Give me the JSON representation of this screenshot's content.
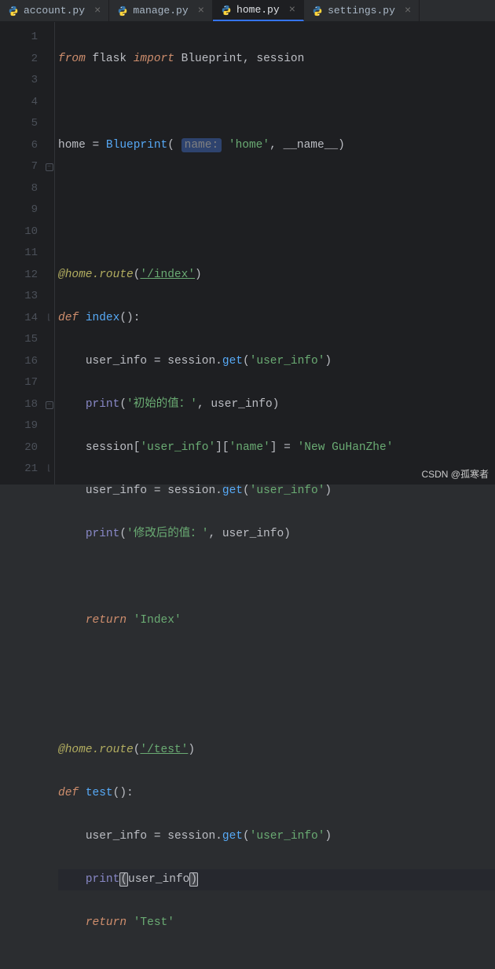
{
  "tabs": [
    {
      "label": "account.py",
      "active": false
    },
    {
      "label": "manage.py",
      "active": false
    },
    {
      "label": "home.py",
      "active": true
    },
    {
      "label": "settings.py",
      "active": false
    }
  ],
  "lines": [
    {
      "n": 1,
      "fold": ""
    },
    {
      "n": 2,
      "fold": ""
    },
    {
      "n": 3,
      "fold": ""
    },
    {
      "n": 4,
      "fold": ""
    },
    {
      "n": 5,
      "fold": ""
    },
    {
      "n": 6,
      "fold": ""
    },
    {
      "n": 7,
      "fold": "⊟"
    },
    {
      "n": 8,
      "fold": ""
    },
    {
      "n": 9,
      "fold": ""
    },
    {
      "n": 10,
      "fold": ""
    },
    {
      "n": 11,
      "fold": ""
    },
    {
      "n": 12,
      "fold": ""
    },
    {
      "n": 13,
      "fold": ""
    },
    {
      "n": 14,
      "fold": "⌊"
    },
    {
      "n": 15,
      "fold": ""
    },
    {
      "n": 16,
      "fold": ""
    },
    {
      "n": 17,
      "fold": ""
    },
    {
      "n": 18,
      "fold": "⊟"
    },
    {
      "n": 19,
      "fold": ""
    },
    {
      "n": 20,
      "fold": ""
    },
    {
      "n": 21,
      "fold": "⌊"
    }
  ],
  "code": {
    "l1_from": "from",
    "l1_flask": "flask",
    "l1_import": "import",
    "l1_bp": "Blueprint",
    "l1_sess": "session",
    "l3_home": "home",
    "l3_bp": "Blueprint",
    "l3_name": "name:",
    "l3_str": "'home'",
    "l3_nm": "__name__",
    "l6_dec": "@home.route",
    "l6_str": "'/index'",
    "l7_def": "def",
    "l7_fn": "index",
    "l8_ui": "user_info",
    "l8_sess": "session",
    "l8_get": "get",
    "l8_str": "'user_info'",
    "l9_print": "print",
    "l9_str": "'初始的值：'",
    "l9_ui": "user_info",
    "l10_sess": "session",
    "l10_s1": "'user_info'",
    "l10_s2": "'name'",
    "l10_s3": "'New GuHanZhe'",
    "l11_ui": "user_info",
    "l11_sess": "session",
    "l11_get": "get",
    "l11_str": "'user_info'",
    "l12_print": "print",
    "l12_str": "'修改后的值：'",
    "l12_ui": "user_info",
    "l14_ret": "return",
    "l14_str": "'Index'",
    "l17_dec": "@home.route",
    "l17_str": "'/test'",
    "l18_def": "def",
    "l18_fn": "test",
    "l19_ui": "user_info",
    "l19_sess": "session",
    "l19_get": "get",
    "l19_str": "'user_info'",
    "l20_print": "print",
    "l20_ui": "user_info",
    "l21_ret": "return",
    "l21_str": "'Test'"
  },
  "watermark": "CSDN @孤寒者"
}
